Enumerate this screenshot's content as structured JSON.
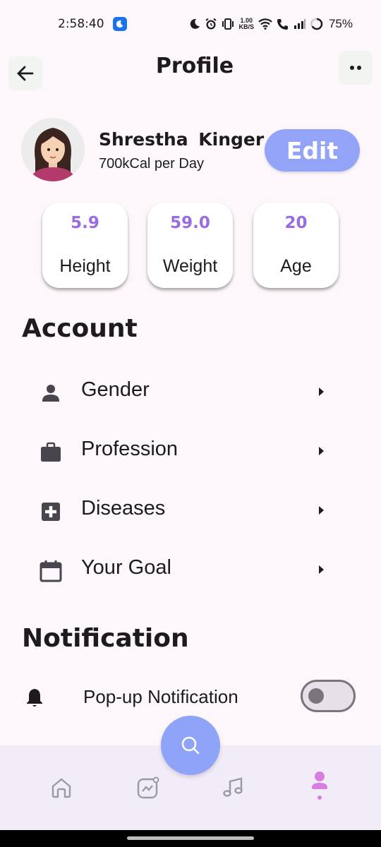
{
  "status_bar": {
    "time": "2:58:40",
    "net_speed_value": "1.00",
    "net_speed_unit": "KB/S",
    "battery": "75%"
  },
  "header": {
    "title": "Profile"
  },
  "profile": {
    "name": "Shrestha  Kinger",
    "subtitle": "700kCal per Day",
    "edit_label": "Edit"
  },
  "stats": [
    {
      "value": "5.9",
      "label": "Height"
    },
    {
      "value": "59.0",
      "label": "Weight"
    },
    {
      "value": "20",
      "label": "Age"
    }
  ],
  "account": {
    "title": "Account",
    "items": [
      {
        "label": "Gender",
        "icon": "person-icon"
      },
      {
        "label": "Profession",
        "icon": "briefcase-icon"
      },
      {
        "label": "Diseases",
        "icon": "medical-plus-icon"
      },
      {
        "label": "Your Goal",
        "icon": "calendar-icon"
      }
    ]
  },
  "notification": {
    "title": "Notification",
    "popup_label": "Pop-up Notification",
    "popup_enabled": false
  },
  "bottom_nav": {
    "items": [
      "home-icon",
      "chart-icon",
      "music-icon",
      "profile-icon"
    ],
    "fab": "search-icon"
  },
  "colors": {
    "accent": "#93a4f8",
    "stat_value": "#9b6be0",
    "background": "#fdf7fc",
    "nav_background": "#f2ecf8",
    "active_nav": "#d77ee0"
  }
}
